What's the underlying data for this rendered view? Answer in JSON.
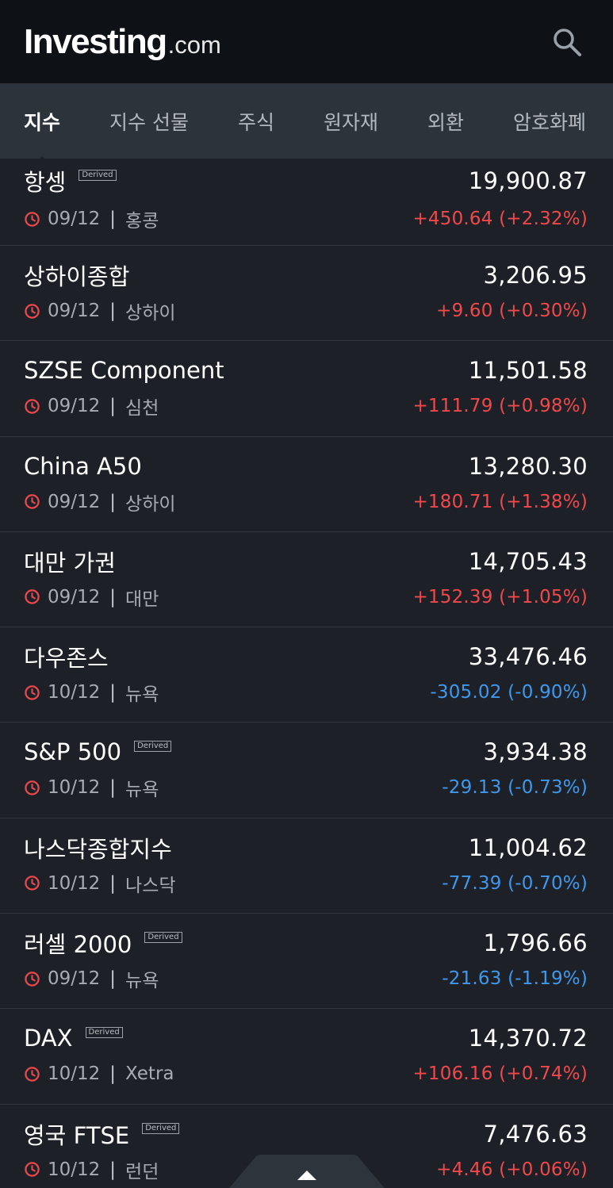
{
  "header": {
    "logo_main": "Investing",
    "logo_suffix": ".com",
    "search_icon": "search-icon"
  },
  "tabs": [
    {
      "label": "지수",
      "active": true
    },
    {
      "label": "지수 선물",
      "active": false
    },
    {
      "label": "주식",
      "active": false
    },
    {
      "label": "원자재",
      "active": false
    },
    {
      "label": "외환",
      "active": false
    },
    {
      "label": "암호화폐",
      "active": false
    }
  ],
  "badge_label": "Derived",
  "colors": {
    "up": "#f0484b",
    "down": "#3f98ec",
    "clock": "#e8484b"
  },
  "indices": [
    {
      "name": "항셍",
      "derived": true,
      "price": "19,900.87",
      "date": "09/12",
      "market": "홍콩",
      "change": "+450.64 (+2.32%)",
      "direction": "up"
    },
    {
      "name": "상하이종합",
      "derived": false,
      "price": "3,206.95",
      "date": "09/12",
      "market": "상하이",
      "change": "+9.60 (+0.30%)",
      "direction": "up"
    },
    {
      "name": "SZSE Component",
      "derived": false,
      "price": "11,501.58",
      "date": "09/12",
      "market": "심천",
      "change": "+111.79 (+0.98%)",
      "direction": "up"
    },
    {
      "name": "China A50",
      "derived": false,
      "price": "13,280.30",
      "date": "09/12",
      "market": "상하이",
      "change": "+180.71 (+1.38%)",
      "direction": "up"
    },
    {
      "name": "대만 가권",
      "derived": false,
      "price": "14,705.43",
      "date": "09/12",
      "market": "대만",
      "change": "+152.39 (+1.05%)",
      "direction": "up"
    },
    {
      "name": "다우존스",
      "derived": false,
      "price": "33,476.46",
      "date": "10/12",
      "market": "뉴욕",
      "change": "-305.02 (-0.90%)",
      "direction": "down"
    },
    {
      "name": "S&P 500",
      "derived": true,
      "price": "3,934.38",
      "date": "10/12",
      "market": "뉴욕",
      "change": "-29.13 (-0.73%)",
      "direction": "down"
    },
    {
      "name": "나스닥종합지수",
      "derived": false,
      "price": "11,004.62",
      "date": "10/12",
      "market": "나스닥",
      "change": "-77.39 (-0.70%)",
      "direction": "down"
    },
    {
      "name": "러셀 2000",
      "derived": true,
      "price": "1,796.66",
      "date": "09/12",
      "market": "뉴욕",
      "change": "-21.63 (-1.19%)",
      "direction": "down"
    },
    {
      "name": "DAX",
      "derived": true,
      "price": "14,370.72",
      "date": "10/12",
      "market": "Xetra",
      "change": "+106.16 (+0.74%)",
      "direction": "up"
    },
    {
      "name": "영국 FTSE",
      "derived": true,
      "price": "7,476.63",
      "date": "10/12",
      "market": "런던",
      "change": "+4.46 (+0.06%)",
      "direction": "up"
    }
  ],
  "scroll_up_icon": "caret-up-icon"
}
